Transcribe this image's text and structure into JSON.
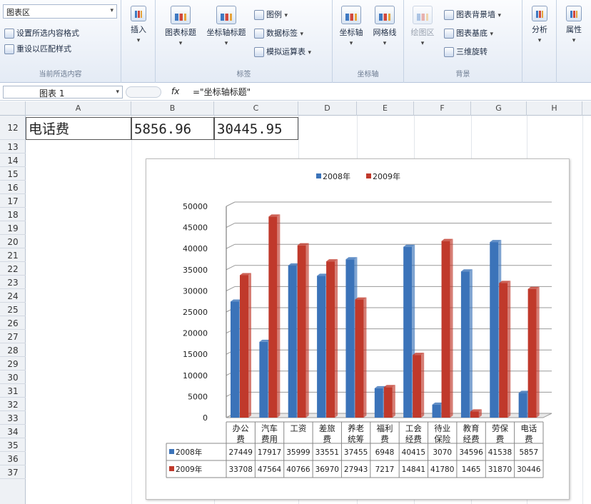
{
  "ribbon": {
    "current_selection": {
      "combo_value": "图表区",
      "format_selection": "设置所选内容格式",
      "reset_style": "重设以匹配样式",
      "label": "当前所选内容"
    },
    "insert": {
      "label": "插入"
    },
    "labels_group": {
      "chart_title": "图表标题",
      "axis_title": "坐标轴标题",
      "legend": "图例",
      "data_labels": "数据标签",
      "data_table": "模拟运算表",
      "label": "标签"
    },
    "axes_group": {
      "axes": "坐标轴",
      "gridlines": "网格线",
      "label": "坐标轴"
    },
    "background_group": {
      "plot_area": "绘图区",
      "chart_wall": "图表背景墙",
      "chart_floor": "图表基底",
      "rotation": "三维旋转",
      "label": "背景"
    },
    "analysis": "分析",
    "properties": "属性"
  },
  "formula_bar": {
    "name_box": "图表 1",
    "fx": "fx",
    "formula": "=\"坐标轴标题\""
  },
  "columns": [
    "A",
    "B",
    "C",
    "D",
    "E",
    "F",
    "G",
    "H"
  ],
  "rows": [
    "12",
    "13",
    "14",
    "15",
    "16",
    "17",
    "18",
    "19",
    "20",
    "21",
    "22",
    "23",
    "24",
    "25",
    "26",
    "27",
    "28",
    "29",
    "30",
    "31",
    "32",
    "33",
    "34",
    "35",
    "36",
    "37"
  ],
  "row12": {
    "a": "电话费",
    "b": "5856.96",
    "c": "30445.95"
  },
  "colors": {
    "s2008": "#3b73b9",
    "s2009": "#c0392b"
  },
  "chart_data": {
    "type": "bar",
    "title": "",
    "legend_position": "top",
    "categories": [
      "办公费",
      "汽车费用",
      "工资",
      "差旅费",
      "养老统筹",
      "福利费",
      "工会经费",
      "待业保险",
      "教育经费",
      "劳保费",
      "电话费"
    ],
    "category_lines": [
      [
        "办公",
        "费"
      ],
      [
        "汽车",
        "费用"
      ],
      [
        "工资"
      ],
      [
        "差旅",
        "费"
      ],
      [
        "养老",
        "统筹"
      ],
      [
        "福利",
        "费"
      ],
      [
        "工会",
        "经费"
      ],
      [
        "待业",
        "保险"
      ],
      [
        "教育",
        "经费"
      ],
      [
        "劳保",
        "费"
      ],
      [
        "电话",
        "费"
      ]
    ],
    "series": [
      {
        "name": "2008年",
        "values": [
          27449,
          17917,
          35999,
          33551,
          37455,
          6948,
          40415,
          3070,
          34596,
          41538,
          5857
        ]
      },
      {
        "name": "2009年",
        "values": [
          33708,
          47564,
          40766,
          36970,
          27943,
          7217,
          14841,
          41780,
          1465,
          31870,
          30446
        ]
      }
    ],
    "y_ticks": [
      "50000",
      "45000",
      "40000",
      "35000",
      "30000",
      "25000",
      "20000",
      "15000",
      "10000",
      "5000",
      "0"
    ],
    "ylim": [
      0,
      50000
    ],
    "grid": true,
    "data_table": true
  }
}
